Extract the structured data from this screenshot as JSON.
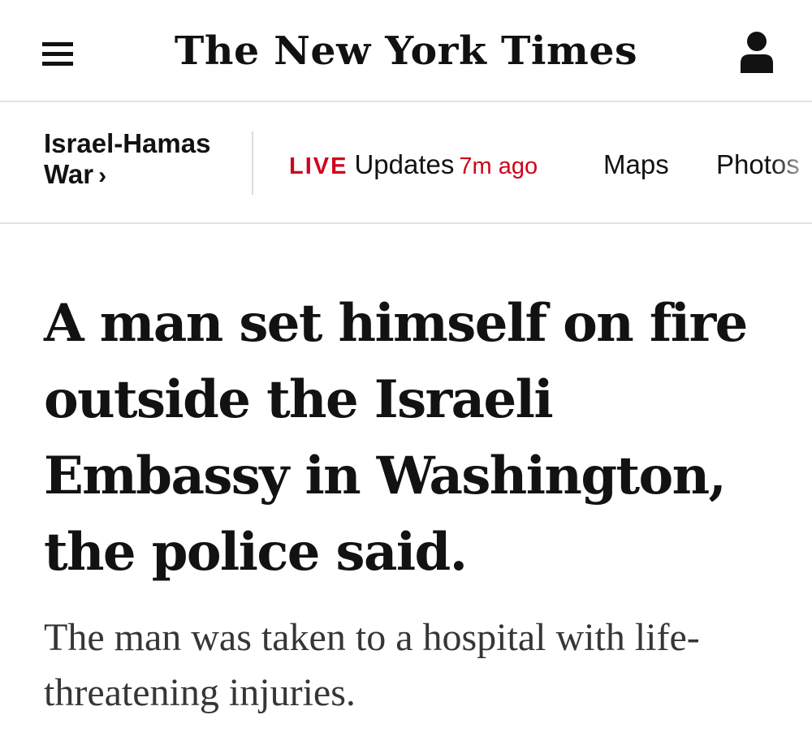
{
  "header": {
    "logo_text": "The New York Times",
    "menu_icon": "hamburger-menu-icon",
    "account_icon": "account-person-icon"
  },
  "subnav": {
    "section_label": "Israel-Hamas War",
    "section_chevron": "›",
    "live_label": "LIVE",
    "updates_label": "Updates",
    "time_ago": "7m ago",
    "maps_label": "Maps",
    "photos_label": "Photos"
  },
  "article": {
    "headline": "A man set himself on fire outside the Israeli Embassy in Washington, the police said.",
    "summary": "The man was taken to a hospital with life-threatening injuries."
  },
  "colors": {
    "live_red": "#d0021b",
    "text": "#121212",
    "summary_text": "#363636",
    "divider": "#e2e2e2"
  }
}
